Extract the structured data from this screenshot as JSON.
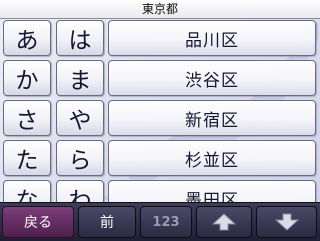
{
  "header": {
    "title": "東京都"
  },
  "keypad": {
    "keys": [
      "あ",
      "は",
      "か",
      "ま",
      "さ",
      "や",
      "た",
      "ら",
      "な",
      "わ"
    ]
  },
  "list": {
    "items": [
      "品川区",
      "渋谷区",
      "新宿区",
      "杉並区",
      "墨田区"
    ]
  },
  "toolbar": {
    "back_label": "戻る",
    "prev_label": "前",
    "numeric_label": "123",
    "up_icon": "arrow-up-icon",
    "down_icon": "arrow-down-icon"
  },
  "colors": {
    "toolbar_bg": "#2a2a42",
    "back_button": "#6b3468",
    "map_tint": "#c8cce6"
  }
}
